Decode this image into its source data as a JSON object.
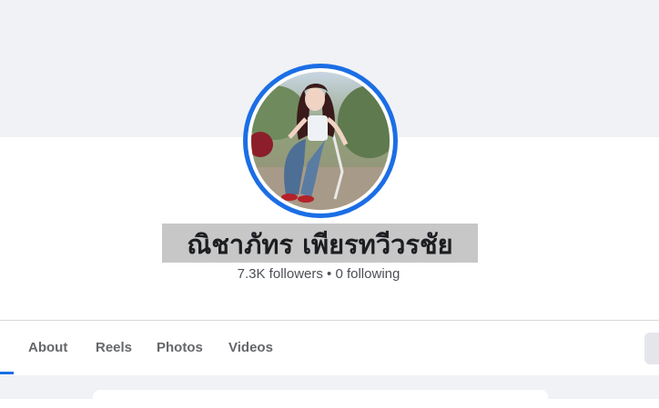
{
  "profile": {
    "name": "ณิชาภัทร เพียรทวีวรชัย",
    "stats": "7.3K followers • 0 following"
  },
  "tabs": [
    {
      "label": "About"
    },
    {
      "label": "Reels"
    },
    {
      "label": "Photos"
    },
    {
      "label": "Videos"
    }
  ],
  "colors": {
    "accent": "#1b6ee5",
    "cover_bg": "#f0f2f5",
    "name_highlight": "#c7c7c7"
  },
  "icons": [
    "profile-photo"
  ]
}
